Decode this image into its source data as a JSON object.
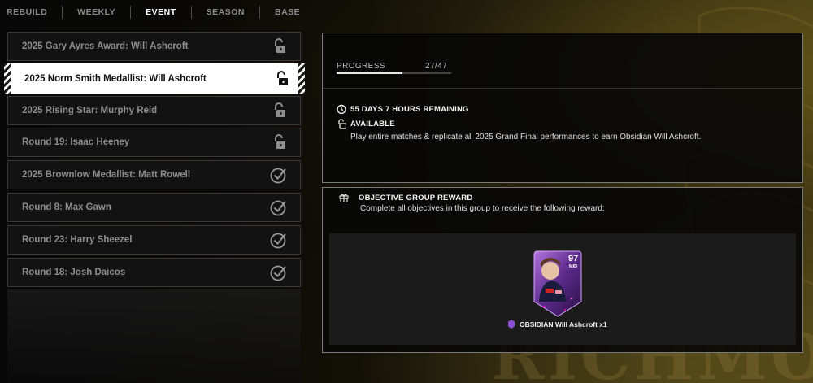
{
  "tabs": [
    {
      "label": "REBUILD",
      "active": false
    },
    {
      "label": "WEEKLY",
      "active": false
    },
    {
      "label": "EVENT",
      "active": true
    },
    {
      "label": "SEASON",
      "active": false
    },
    {
      "label": "BASE",
      "active": false
    }
  ],
  "objectives": [
    {
      "label": "2025 Gary Ayres Award: Will Ashcroft",
      "status": "unlocked"
    },
    {
      "label": "2025 Norm Smith Medallist: Will Ashcroft",
      "status": "unlocked",
      "selected": true
    },
    {
      "label": "2025 Rising Star: Murphy Reid",
      "status": "unlocked"
    },
    {
      "label": "Round 19: Isaac Heeney",
      "status": "unlocked"
    },
    {
      "label": "2025 Brownlow Medallist: Matt Rowell",
      "status": "completed"
    },
    {
      "label": "Round 8: Max Gawn",
      "status": "completed"
    },
    {
      "label": "Round 23: Harry Sheezel",
      "status": "completed"
    },
    {
      "label": "Round 18: Josh Daicos",
      "status": "completed"
    }
  ],
  "detail": {
    "progress_label": "PROGRESS",
    "progress_count": "27/47",
    "progress_fraction": 0.574,
    "time_remaining": "55 DAYS 7 HOURS REMAINING",
    "availability": "AVAILABLE",
    "description": "Play entire matches & replicate all 2025 Grand Final performances to earn Obsidian Will Ashcroft."
  },
  "reward": {
    "title": "OBJECTIVE GROUP REWARD",
    "subtitle": "Complete all objectives in this group to receive the following reward:",
    "card_rating": "97",
    "card_position": "MID",
    "card_name": "OBSIDIAN Will Ashcroft x1"
  },
  "background": {
    "watermark": "RICHMO"
  },
  "colors": {
    "accent_gold": "#8a7426",
    "obsidian_purple": "#8a4fd0",
    "selected_bg": "#ffffff"
  }
}
